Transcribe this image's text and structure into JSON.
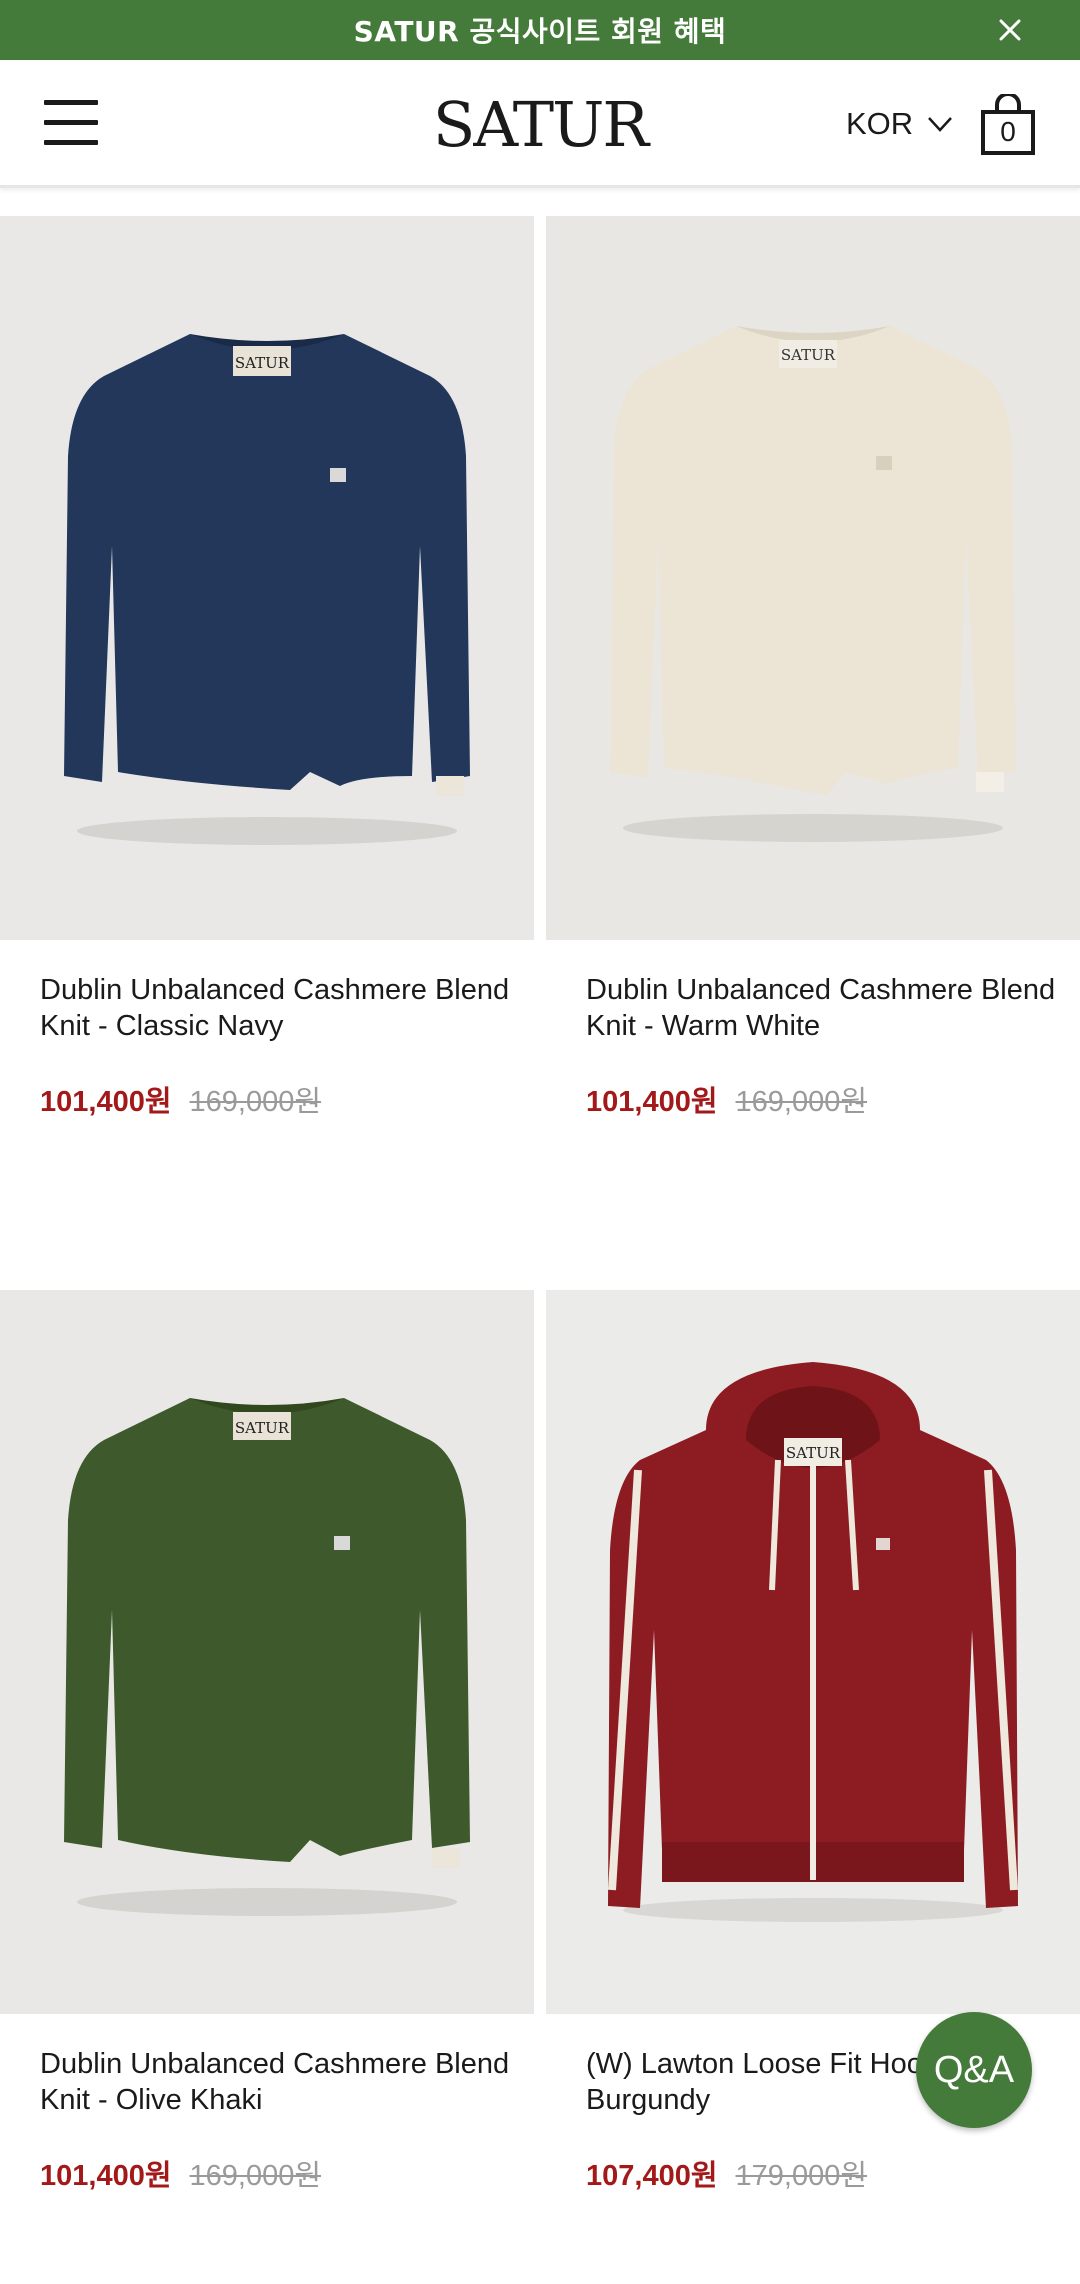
{
  "promo": {
    "text": "SATUR 공식사이트 회원 혜택",
    "close_icon": "close-icon",
    "background": "#447a3a"
  },
  "header": {
    "logo": "SATUR",
    "menu_icon": "hamburger-menu-icon",
    "language": "KOR",
    "language_icon": "chevron-down-icon",
    "cart_icon": "shopping-bag-icon",
    "cart_count": "0"
  },
  "products": [
    {
      "name": "Dublin Unbalanced Cashmere Blend Knit - Classic Navy",
      "sale_price": "101,400원",
      "original_price": "169,000원",
      "color": "#22375a",
      "type": "sweater"
    },
    {
      "name": "Dublin Unbalanced Cashmere Blend Knit - Warm White",
      "sale_price": "101,400원",
      "original_price": "169,000원",
      "color": "#ece5d6",
      "type": "sweater"
    },
    {
      "name": "Dublin Unbalanced Cashmere Blend Knit - Olive Khaki",
      "sale_price": "101,400원",
      "original_price": "169,000원",
      "color": "#3e5a2c",
      "type": "sweater"
    },
    {
      "name": "(W) Lawton Loose Fit Hood-up - Burgundy",
      "sale_price": "107,400원",
      "original_price": "179,000원",
      "color": "#8c1c22",
      "type": "hoodie"
    }
  ],
  "floating": {
    "qa_label": "Q&A",
    "background": "#447a3a"
  },
  "colors": {
    "sale_price": "#a31919",
    "original_price": "#9a9a9a"
  }
}
